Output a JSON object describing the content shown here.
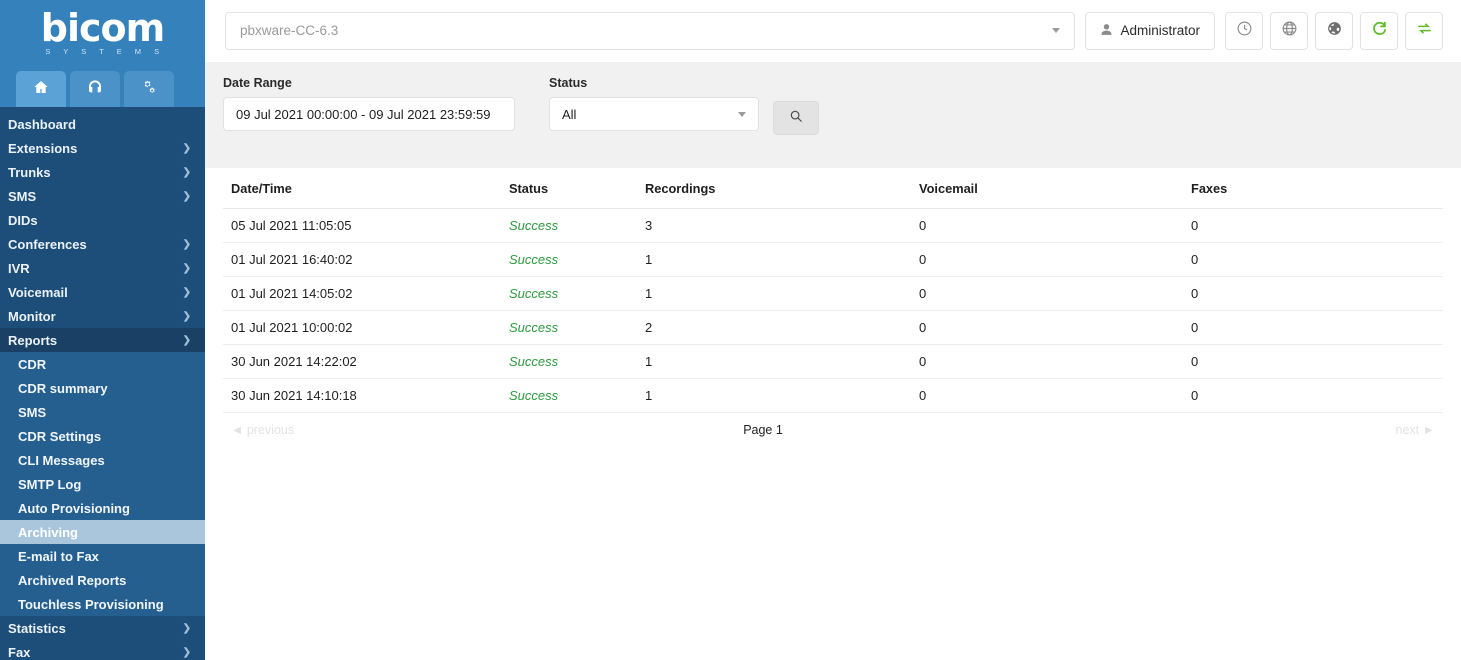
{
  "sidebar": {
    "logo": {
      "main": "bicom",
      "sub": "S Y S T E M S"
    },
    "icon_tabs": [
      {
        "name": "home-icon",
        "label": "Home"
      },
      {
        "name": "support-icon",
        "label": "Support"
      },
      {
        "name": "settings-gears-icon",
        "label": "Settings"
      }
    ],
    "items": [
      {
        "label": "Dashboard",
        "expandable": false
      },
      {
        "label": "Extensions",
        "expandable": true
      },
      {
        "label": "Trunks",
        "expandable": true
      },
      {
        "label": "SMS",
        "expandable": true
      },
      {
        "label": "DIDs",
        "expandable": false
      },
      {
        "label": "Conferences",
        "expandable": true
      },
      {
        "label": "IVR",
        "expandable": true
      },
      {
        "label": "Voicemail",
        "expandable": true
      },
      {
        "label": "Monitor",
        "expandable": true
      },
      {
        "label": "Reports",
        "expandable": true,
        "expanded": true
      }
    ],
    "reports_submenu": [
      {
        "label": "CDR"
      },
      {
        "label": "CDR summary"
      },
      {
        "label": "SMS"
      },
      {
        "label": "CDR Settings"
      },
      {
        "label": "CLI Messages"
      },
      {
        "label": "SMTP Log"
      },
      {
        "label": "Auto Provisioning"
      },
      {
        "label": "Archiving",
        "active": true
      },
      {
        "label": "E-mail to Fax"
      },
      {
        "label": "Archived Reports"
      },
      {
        "label": "Touchless Provisioning"
      }
    ],
    "items_after": [
      {
        "label": "Statistics",
        "expandable": true
      },
      {
        "label": "Fax",
        "expandable": true
      }
    ],
    "colors": {
      "bg": "#1d4e79",
      "submenu_bg": "#255f90",
      "active_bg": "#a9c6dd",
      "logo_bg": "#3481bb"
    }
  },
  "topbar": {
    "server": "pbxware-CC-6.3",
    "admin_label": "Administrator",
    "icon_buttons": [
      {
        "name": "clock-icon",
        "color": "#8a8a8a"
      },
      {
        "name": "globe-grid-icon",
        "color": "#8a8a8a"
      },
      {
        "name": "earth-icon",
        "color": "#6e6e6e"
      },
      {
        "name": "refresh-icon",
        "color": "#5cbb23"
      },
      {
        "name": "sync-icon",
        "color": "#5cbb23"
      }
    ]
  },
  "filters": {
    "date_range_label": "Date Range",
    "date_range_value": "09 Jul 2021 00:00:00 - 09 Jul 2021 23:59:59",
    "status_label": "Status",
    "status_value": "All",
    "search_icon": "search-icon"
  },
  "table": {
    "columns": [
      "Date/Time",
      "Status",
      "Recordings",
      "Voicemail",
      "Faxes"
    ],
    "rows": [
      {
        "datetime": "05 Jul 2021 11:05:05",
        "status": "Success",
        "recordings": "3",
        "voicemail": "0",
        "faxes": "0"
      },
      {
        "datetime": "01 Jul 2021 16:40:02",
        "status": "Success",
        "recordings": "1",
        "voicemail": "0",
        "faxes": "0"
      },
      {
        "datetime": "01 Jul 2021 14:05:02",
        "status": "Success",
        "recordings": "1",
        "voicemail": "0",
        "faxes": "0"
      },
      {
        "datetime": "01 Jul 2021 10:00:02",
        "status": "Success",
        "recordings": "2",
        "voicemail": "0",
        "faxes": "0"
      },
      {
        "datetime": "30 Jun 2021 14:22:02",
        "status": "Success",
        "recordings": "1",
        "voicemail": "0",
        "faxes": "0"
      },
      {
        "datetime": "30 Jun 2021 14:10:18",
        "status": "Success",
        "recordings": "1",
        "voicemail": "0",
        "faxes": "0"
      }
    ],
    "status_color": "#2e9b3f"
  },
  "pagination": {
    "previous": "◄ previous",
    "page": "Page 1",
    "next": "next ►"
  }
}
